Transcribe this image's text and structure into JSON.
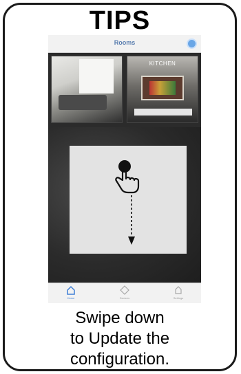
{
  "tips_title": "TIPS",
  "app": {
    "nav_title": "Rooms",
    "rooms": [
      {
        "label": ""
      },
      {
        "label": "KITCHEN"
      }
    ],
    "tabs": [
      {
        "label": "Home",
        "icon": "home-icon",
        "active": true
      },
      {
        "label": "Devices",
        "icon": "devices-icon",
        "active": false
      },
      {
        "label": "Settings",
        "icon": "settings-icon",
        "active": false
      }
    ],
    "accent_color": "#3f7fd6"
  },
  "instruction": {
    "gesture_icon": "hand-pointer-icon",
    "direction_icon": "arrow-down-icon"
  },
  "caption": {
    "line1": "Swipe down",
    "line2": "to Update the",
    "line3": "configuration."
  }
}
